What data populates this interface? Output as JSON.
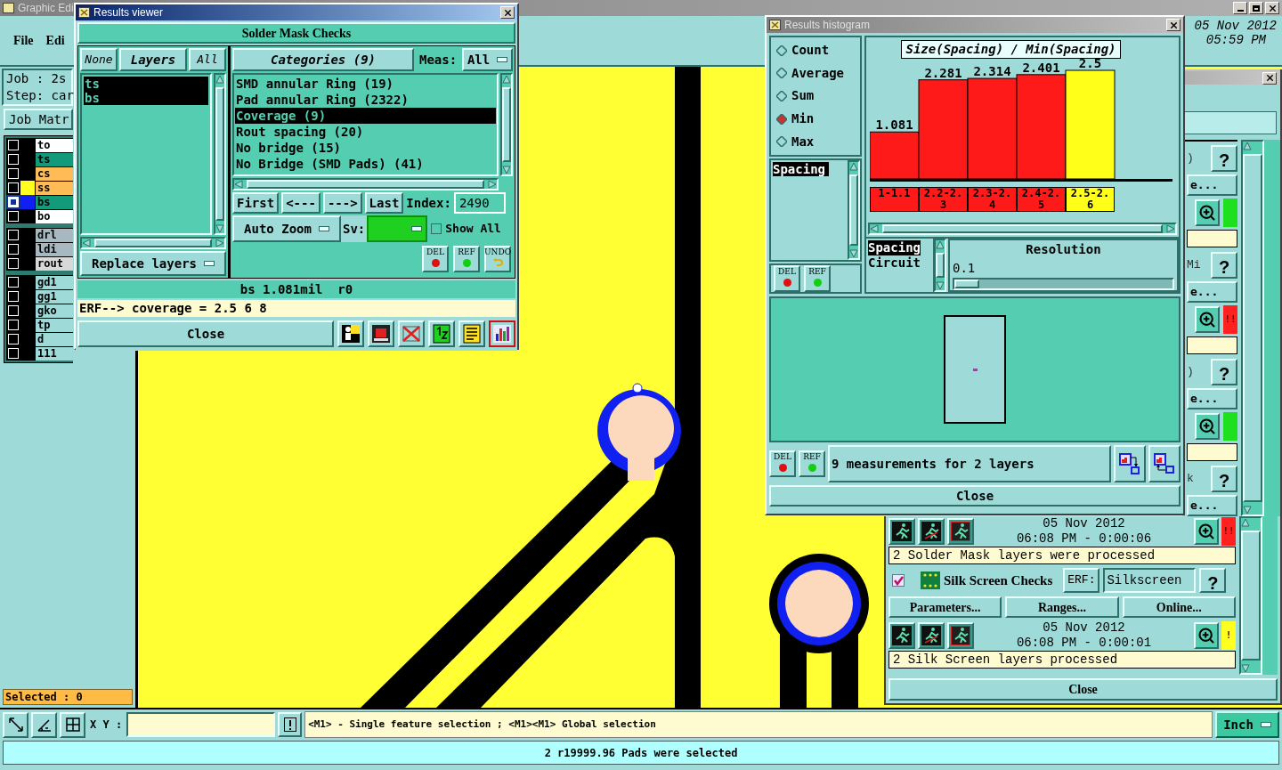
{
  "main_window": {
    "title": "Graphic Edi",
    "menu": [
      "File",
      "Edi"
    ],
    "date": "05 Nov 2012",
    "time": "05:59 PM",
    "job": "Job : 2s",
    "step": "Step: car",
    "job_matrix_button": "Job Matr",
    "layer_groups": [
      [
        {
          "name": "to",
          "kind": "plain",
          "selected": false
        },
        {
          "name": "ts",
          "kind": "mask",
          "selected": false
        },
        {
          "name": "cs",
          "kind": "silk",
          "selected": false
        },
        {
          "name": "ss",
          "kind": "silk",
          "color": "#ffff20",
          "selected": false
        },
        {
          "name": "bs",
          "kind": "mask",
          "color": "#1020f0",
          "selected": true
        },
        {
          "name": "bo",
          "kind": "plain",
          "selected": false
        }
      ],
      [
        {
          "name": "drl",
          "kind": "drill",
          "selected": false
        },
        {
          "name": "ldi",
          "kind": "drill",
          "selected": false
        },
        {
          "name": "rout",
          "kind": "rout",
          "selected": false
        }
      ],
      [
        {
          "name": "gd1",
          "kind": "misc",
          "selected": false
        },
        {
          "name": "gg1",
          "kind": "misc",
          "selected": false
        },
        {
          "name": "gko",
          "kind": "misc",
          "selected": false
        },
        {
          "name": "tp",
          "kind": "misc",
          "selected": false
        },
        {
          "name": "d",
          "kind": "misc",
          "selected": false
        },
        {
          "name": "111",
          "kind": "misc",
          "selected": false
        }
      ]
    ],
    "selected_count": "Selected : 0"
  },
  "results_viewer": {
    "title": "Results viewer",
    "header": "Solder Mask Checks",
    "layer_buttons": [
      {
        "label": "None",
        "kind": "button"
      },
      {
        "label": "Layers",
        "kind": "title"
      },
      {
        "label": "All",
        "kind": "button"
      }
    ],
    "layers": [
      {
        "name": "ts",
        "selected": true
      },
      {
        "name": "bs",
        "selected": true
      }
    ],
    "replace_mode": "Replace layers",
    "categories_button": "Categories (9)",
    "meas_label": "Meas:",
    "meas_value": "All",
    "categories": [
      {
        "name": "SMD annular Ring (19)",
        "selected": false
      },
      {
        "name": "Pad annular Ring (2322)",
        "selected": false
      },
      {
        "name": "Coverage (9)",
        "selected": true
      },
      {
        "name": "Rout spacing (20)",
        "selected": false
      },
      {
        "name": "No bridge (15)",
        "selected": false
      },
      {
        "name": "No Bridge (SMD Pads) (41)",
        "selected": false
      }
    ],
    "nav_buttons": [
      "First",
      "<---",
      "--->",
      "Last"
    ],
    "index_label": "Index:",
    "index_value": "2490",
    "zoom_mode": "Auto Zoom",
    "sv_label": "Sv:",
    "show_all": {
      "label": "Show All",
      "checked": false
    },
    "action_buttons": [
      {
        "label": "DEL",
        "kind": "delete"
      },
      {
        "label": "REF",
        "kind": "refresh"
      },
      {
        "label": "UNDO",
        "kind": "undo"
      }
    ],
    "measurement": "bs 1.081mil  r0",
    "erf_line": "ERF--> coverage = 2.5 6 8",
    "close": "Close",
    "tools": [
      {
        "selected": false
      },
      {
        "selected": false
      },
      {
        "selected": false
      },
      {
        "selected": false
      },
      {
        "selected": false
      },
      {
        "selected": true
      }
    ]
  },
  "histogram": {
    "title": "Results histogram",
    "modes": [
      {
        "label": "Count",
        "selected": false
      },
      {
        "label": "Average",
        "selected": false
      },
      {
        "label": "Sum",
        "selected": false
      },
      {
        "label": "Min",
        "selected": true
      },
      {
        "label": "Max",
        "selected": false
      }
    ],
    "fields": [
      {
        "name": "Spacing",
        "selected": true
      }
    ],
    "chart_data": {
      "type": "bar",
      "title": "Size(Spacing) / Min(Spacing)",
      "categories": [
        "1-1.1",
        "2.2-2.3",
        "2.3-2.4",
        "2.4-2.5",
        "2.5-2.6"
      ],
      "series": [
        {
          "color": "#ff1a1a",
          "values": [
            1.081,
            2.281,
            2.314,
            2.401,
            null
          ]
        },
        {
          "color": "#ffff1a",
          "values": [
            null,
            null,
            null,
            null,
            2.5
          ]
        }
      ],
      "stacked": true,
      "data_labels": true
    },
    "attributes": [
      {
        "name": "Spacing",
        "selected": true
      },
      {
        "name": "Circuit",
        "selected": false
      }
    ],
    "resolution_label": "Resolution",
    "resolution_value": "0.1",
    "resolution": {
      "level": 0
    },
    "side_buttons": [
      {
        "label": "DEL",
        "kind": "delete"
      },
      {
        "label": "REF",
        "kind": "refresh"
      }
    ],
    "bottom_buttons": [
      {
        "label": "DEL",
        "kind": "delete"
      },
      {
        "label": "REF",
        "kind": "refresh"
      }
    ],
    "summary": "9 measurements for 2 layers",
    "close": "Close"
  },
  "checks_window": {
    "groups": [
      {
        "fragment": ")",
        "help": "?",
        "more": "e...",
        "status": {
          "color": "#1ee01e"
        }
      },
      {
        "fragment": "Mi",
        "help": "?",
        "more": "e...",
        "status": {
          "color": "#ff2020",
          "text": "!!"
        }
      },
      {
        "fragment": ")",
        "help": "?",
        "more": "e...",
        "status": {
          "color": "#1ee01e"
        }
      }
    ],
    "last_group": {
      "fragment": "k",
      "help": "?",
      "more": "e..."
    },
    "solder_run": {
      "date": "05 Nov 2012",
      "time": "06:08 PM - 0:00:06",
      "status": {
        "color": "#ff2020",
        "text": "!!"
      },
      "message": "2 Solder Mask layers were processed"
    },
    "silk": {
      "checked": true,
      "title": "Silk Screen Checks",
      "erf_label": "ERF:",
      "erf_value": "Silkscreen",
      "help": "?",
      "buttons": [
        "Parameters...",
        "Ranges...",
        "Online..."
      ]
    },
    "silk_run": {
      "date": "05 Nov 2012",
      "time": "06:08 PM - 0:00:01",
      "status": {
        "color": "#ffff20",
        "text": "!"
      },
      "message": "2 Silk Screen layers processed"
    },
    "close": "Close"
  },
  "toolbar": {
    "xy_label": "X Y :",
    "hint": "<M1> - Single feature selection ; <M1><M1> Global selection",
    "units": "Inch"
  },
  "status_bar": "2 r19999.96 Pads were selected"
}
